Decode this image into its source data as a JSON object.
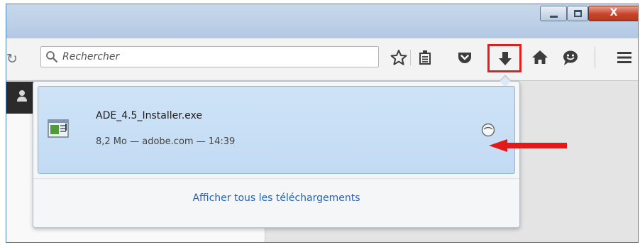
{
  "toolbar": {
    "search_placeholder": "Rechercher"
  },
  "download": {
    "file_name": "ADE_4.5_Installer.exe",
    "meta": "8,2 Mo — adobe.com — 14:39"
  },
  "panel": {
    "show_all_label": "Afficher tous les téléchargements"
  },
  "window": {
    "close_label": "X"
  },
  "icons": {
    "reload": "reload-icon",
    "search": "search-icon",
    "bookmark": "star-icon",
    "reading_list": "reading-list-icon",
    "pocket": "pocket-icon",
    "downloads": "download-arrow-icon",
    "home": "home-icon",
    "chat": "chat-icon",
    "menu": "hamburger-menu-icon",
    "file": "installer-file-icon",
    "retry": "retry-icon"
  },
  "colors": {
    "highlight_box": "#df2020",
    "annotation_arrow": "#e01b1b",
    "link": "#2862b4",
    "selected_item": "#c8dff5"
  }
}
